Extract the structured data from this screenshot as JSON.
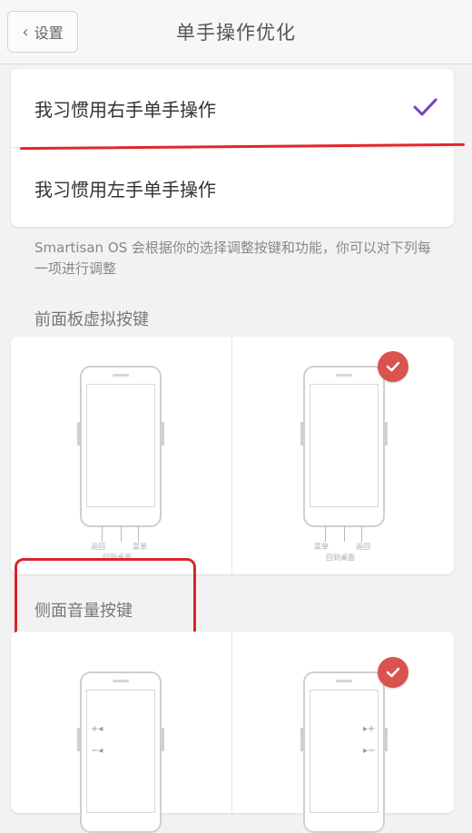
{
  "header": {
    "back_label": "设置",
    "title": "单手操作优化"
  },
  "hand_options": {
    "right_hand": "我习惯用右手单手操作",
    "left_hand": "我习惯用左手单手操作",
    "selected": "right_hand"
  },
  "description": "Smartisan OS 会根据你的选择调整按键和功能，你可以对下列每一项进行调整",
  "sections": {
    "front_panel": {
      "title": "前面板虚拟按键",
      "option_a": {
        "key_left": "返回",
        "key_right": "菜单",
        "center": "回到桌面",
        "selected": false
      },
      "option_b": {
        "key_left": "菜单",
        "key_right": "返回",
        "center": "回到桌面",
        "selected": true
      }
    },
    "side_volume": {
      "title": "侧面音量按键",
      "option_b_selected": true
    }
  },
  "colors": {
    "accent_check": "#7b3fbf",
    "badge": "#d9534f",
    "highlight_red": "#e1272a"
  }
}
